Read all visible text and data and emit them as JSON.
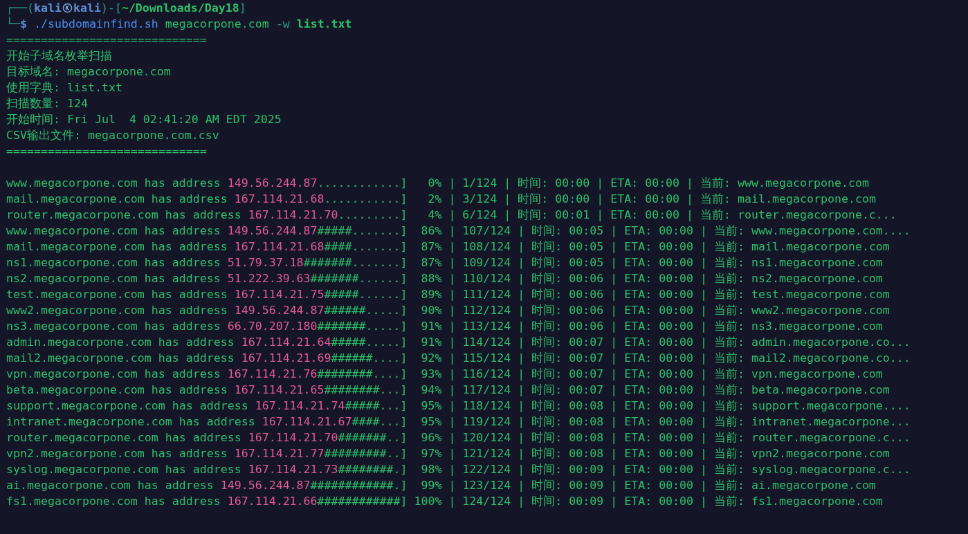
{
  "prompt": {
    "line1": [
      {
        "kind": "frame",
        "text": "┌──("
      },
      {
        "kind": "user",
        "text": "kali"
      },
      {
        "kind": "symbol"
      },
      {
        "kind": "user",
        "text": "kali"
      },
      {
        "kind": "frame",
        "text": ")-["
      },
      {
        "kind": "path",
        "text": "~/Downloads/Day18"
      },
      {
        "kind": "frame",
        "text": "]"
      }
    ],
    "line2": [
      {
        "kind": "frame",
        "text": "└─"
      },
      {
        "kind": "dollar",
        "text": "$"
      },
      {
        "kind": "command",
        "text": "./subdomainfind.sh"
      },
      {
        "kind": "arg",
        "text": "megacorpone.com"
      },
      {
        "kind": "flag",
        "text": "-w"
      },
      {
        "kind": "file",
        "text": "list.txt"
      }
    ]
  },
  "header": [
    "=============================",
    "开始子域名枚举扫描",
    "目标域名: megacorpone.com",
    "使用字典: list.txt",
    "扫描数量: 124",
    "开始时间: Fri Jul  4 02:41:20 AM EDT 2025",
    "CSV输出文件: megacorpone.com.csv",
    "============================="
  ],
  "rows": [
    {
      "lookup": "www.megacorpone.com has address",
      "ip": "149.56.244.87",
      "progress": "............]   0% | 1/124 | 时间: 00:00 | ETA: 00:00 | 当前: www.megacorpone.com"
    },
    {
      "lookup": "mail.megacorpone.com has address",
      "ip": "167.114.21.68",
      "progress": "...........]   2% | 3/124 | 时间: 00:00 | ETA: 00:00 | 当前: mail.megacorpone.com"
    },
    {
      "lookup": "router.megacorpone.com has address",
      "ip": "167.114.21.70",
      "progress": ".........]   4% | 6/124 | 时间: 00:01 | ETA: 00:00 | 当前: router.megacorpone.c..."
    },
    {
      "lookup": "www.megacorpone.com has address",
      "ip": "149.56.244.87",
      "progress": "#####.......]  86% | 107/124 | 时间: 00:05 | ETA: 00:00 | 当前: www.megacorpone.com...."
    },
    {
      "lookup": "mail.megacorpone.com has address",
      "ip": "167.114.21.68",
      "progress": "####.......]  87% | 108/124 | 时间: 00:05 | ETA: 00:00 | 当前: mail.megacorpone.com"
    },
    {
      "lookup": "ns1.megacorpone.com has address",
      "ip": "51.79.37.18",
      "progress": "#######.......]  87% | 109/124 | 时间: 00:05 | ETA: 00:00 | 当前: ns1.megacorpone.com"
    },
    {
      "lookup": "ns2.megacorpone.com has address",
      "ip": "51.222.39.63",
      "progress": "#######......]  88% | 110/124 | 时间: 00:06 | ETA: 00:00 | 当前: ns2.megacorpone.com"
    },
    {
      "lookup": "test.megacorpone.com has address",
      "ip": "167.114.21.75",
      "progress": "#####......]  89% | 111/124 | 时间: 00:06 | ETA: 00:00 | 当前: test.megacorpone.com"
    },
    {
      "lookup": "www2.megacorpone.com has address",
      "ip": "149.56.244.87",
      "progress": "######.....]  90% | 112/124 | 时间: 00:06 | ETA: 00:00 | 当前: www2.megacorpone.com"
    },
    {
      "lookup": "ns3.megacorpone.com has address",
      "ip": "66.70.207.180",
      "progress": "#######.....]  91% | 113/124 | 时间: 00:06 | ETA: 00:00 | 当前: ns3.megacorpone.com"
    },
    {
      "lookup": "admin.megacorpone.com has address",
      "ip": "167.114.21.64",
      "progress": "#####.....]  91% | 114/124 | 时间: 00:07 | ETA: 00:00 | 当前: admin.megacorpone.co..."
    },
    {
      "lookup": "mail2.megacorpone.com has address",
      "ip": "167.114.21.69",
      "progress": "######....]  92% | 115/124 | 时间: 00:07 | ETA: 00:00 | 当前: mail2.megacorpone.co..."
    },
    {
      "lookup": "vpn.megacorpone.com has address",
      "ip": "167.114.21.76",
      "progress": "########....]  93% | 116/124 | 时间: 00:07 | ETA: 00:00 | 当前: vpn.megacorpone.com"
    },
    {
      "lookup": "beta.megacorpone.com has address",
      "ip": "167.114.21.65",
      "progress": "########...]  94% | 117/124 | 时间: 00:07 | ETA: 00:00 | 当前: beta.megacorpone.com"
    },
    {
      "lookup": "support.megacorpone.com has address",
      "ip": "167.114.21.74",
      "progress": "#####...]  95% | 118/124 | 时间: 00:08 | ETA: 00:00 | 当前: support.megacorpone...."
    },
    {
      "lookup": "intranet.megacorpone.com has address",
      "ip": "167.114.21.67",
      "progress": "####...]  95% | 119/124 | 时间: 00:08 | ETA: 00:00 | 当前: intranet.megacorpone..."
    },
    {
      "lookup": "router.megacorpone.com has address",
      "ip": "167.114.21.70",
      "progress": "#######..]  96% | 120/124 | 时间: 00:08 | ETA: 00:00 | 当前: router.megacorpone.c..."
    },
    {
      "lookup": "vpn2.megacorpone.com has address",
      "ip": "167.114.21.77",
      "progress": "#########..]  97% | 121/124 | 时间: 00:08 | ETA: 00:00 | 当前: vpn2.megacorpone.com"
    },
    {
      "lookup": "syslog.megacorpone.com has address",
      "ip": "167.114.21.73",
      "progress": "########.]  98% | 122/124 | 时间: 00:09 | ETA: 00:00 | 当前: syslog.megacorpone.c..."
    },
    {
      "lookup": "ai.megacorpone.com has address",
      "ip": "149.56.244.87",
      "progress": "############.]  99% | 123/124 | 时间: 00:09 | ETA: 00:00 | 当前: ai.megacorpone.com"
    },
    {
      "lookup": "fs1.megacorpone.com has address",
      "ip": "167.114.21.66",
      "progress": "############] 100% | 124/124 | 时间: 00:09 | ETA: 00:00 | 当前: fs1.megacorpone.com"
    }
  ]
}
